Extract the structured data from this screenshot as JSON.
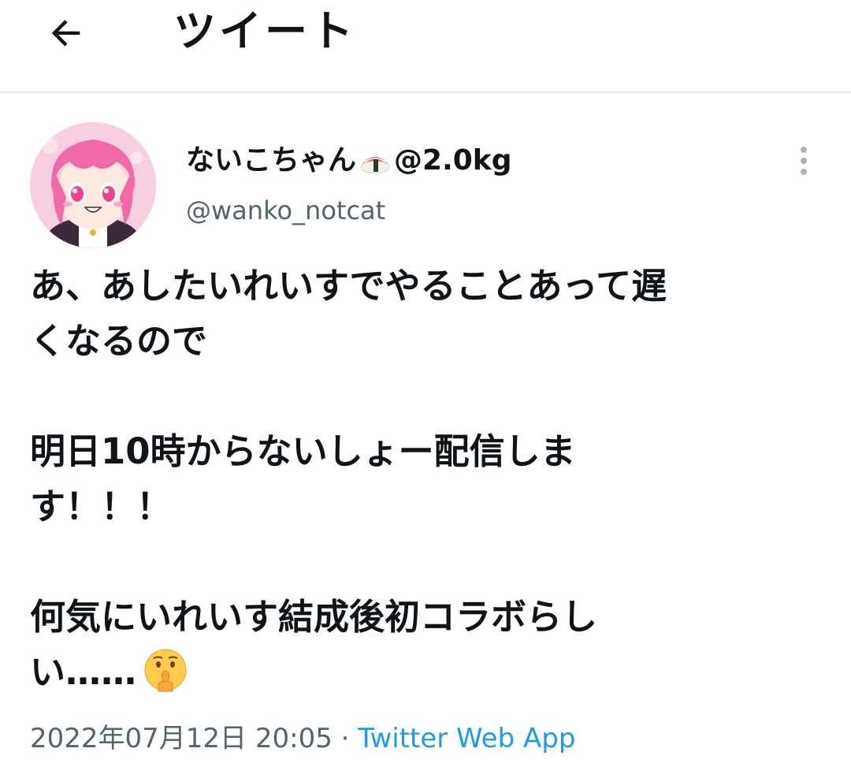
{
  "header": {
    "back_icon": "arrow-left-icon",
    "title": "ツイート"
  },
  "tweet": {
    "display_name_prefix": "ないこちゃん",
    "display_name_emoji": "sushi-icon",
    "display_name_suffix": "@2.0kg",
    "handle": "@wanko_notcat",
    "more_icon": "more-vertical-icon",
    "lines": {
      "l1": "あ、あしたいれいすでやることあって遅",
      "l2": "くなるので",
      "l3": "明日10時からないしょー配信しま",
      "l4": "す！！！",
      "l5": "何気にいれいす結成後初コラボらし",
      "l6": "い……"
    },
    "trailing_emoji": "shushing-face-icon",
    "timestamp": "2022年07月12日 20:05",
    "separator": " · ",
    "source": "Twitter Web App",
    "colors": {
      "text": "#0f1419",
      "secondary": "#536471",
      "link": "#1d9bf0"
    }
  }
}
